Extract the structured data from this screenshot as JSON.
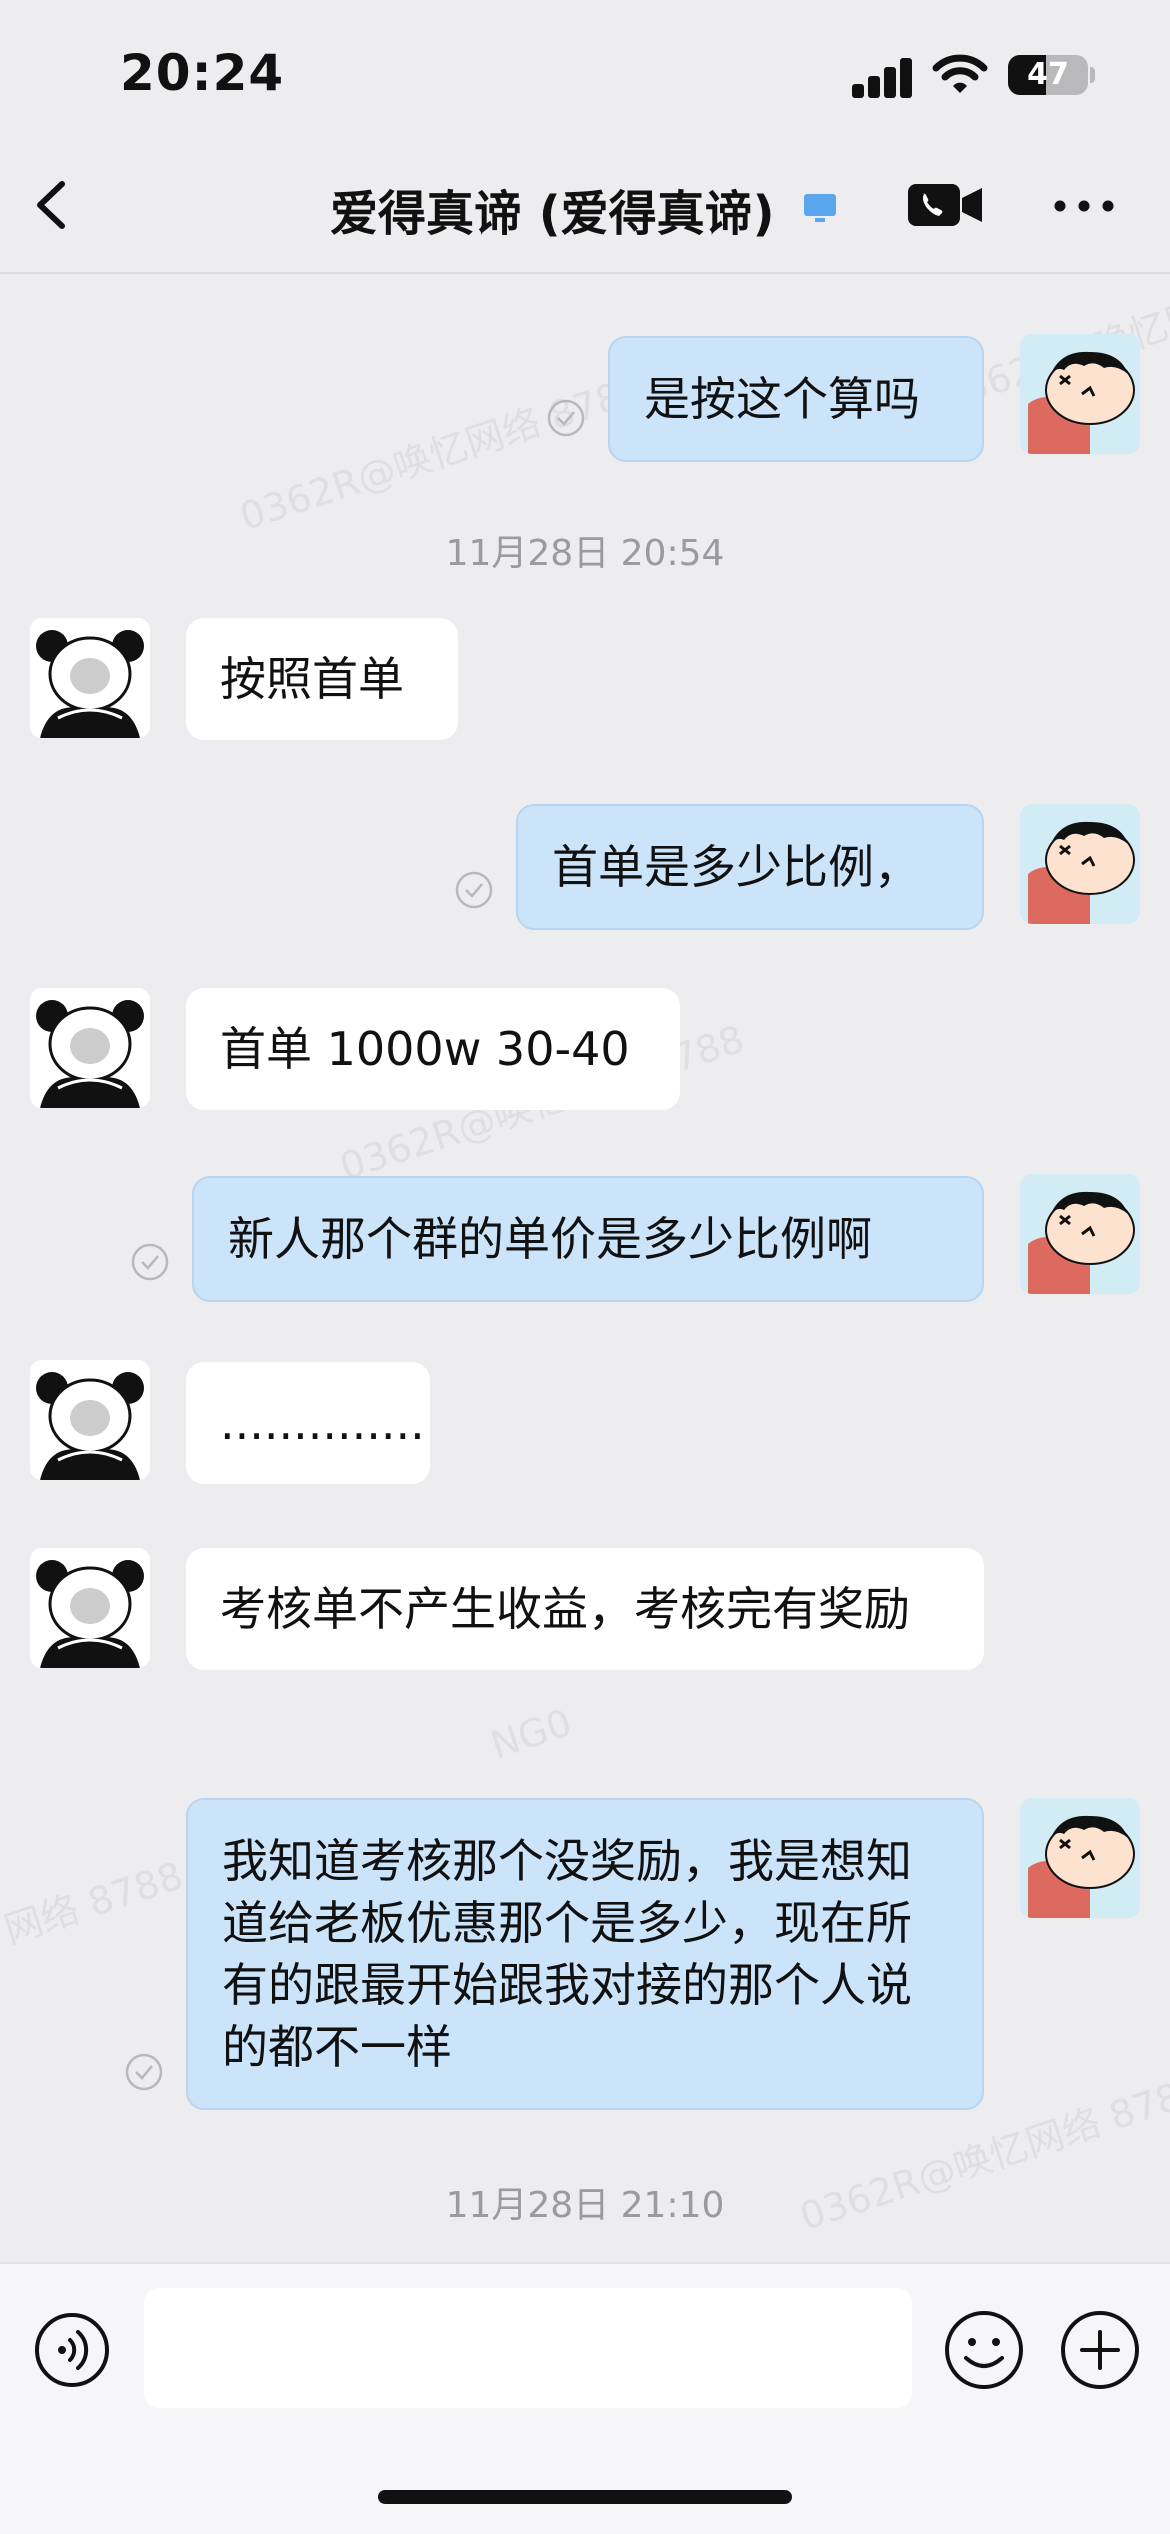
{
  "status_bar": {
    "time": "20:24",
    "battery": "47",
    "battery_level": 0.47
  },
  "header": {
    "title": "爱得真谛 (爱得真谛)"
  },
  "messages": [
    {
      "side": "right",
      "text": "是按这个算吗"
    },
    {
      "type": "timestamp",
      "text": "11月28日 20:54"
    },
    {
      "side": "left",
      "text": "按照首单"
    },
    {
      "side": "right",
      "text": "首单是多少比例，"
    },
    {
      "side": "left",
      "text": "首单 1000w 30-40"
    },
    {
      "side": "right",
      "text": "新人那个群的单价是多少比例啊"
    },
    {
      "side": "left",
      "text": ".............."
    },
    {
      "side": "left",
      "text": "考核单不产生收益，考核完有奖励"
    },
    {
      "side": "right",
      "text": "我知道考核那个没奖励，我是想知道给老板优惠那个是多少，现在所有的跟最开始跟我对接的那个人说的都不一样"
    },
    {
      "type": "timestamp",
      "text": "11月28日 21:10"
    }
  ],
  "watermarks": [
    "0362R@唤忆网络 8788",
    "NG0",
    "网络 8788"
  ],
  "input": {
    "placeholder": "",
    "value": ""
  }
}
